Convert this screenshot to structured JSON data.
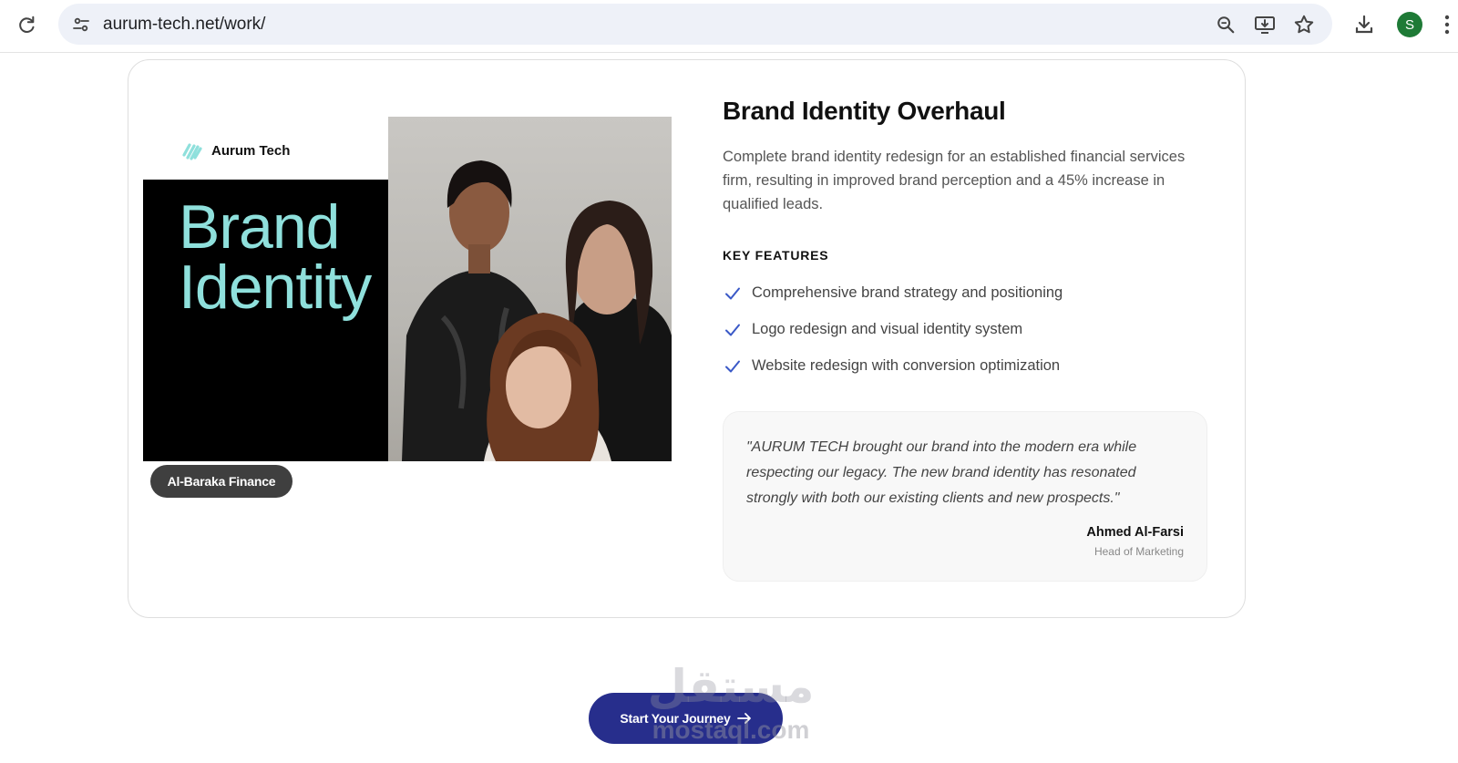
{
  "browser": {
    "url": "aurum-tech.net/work/",
    "avatar_letter": "S",
    "avatar_color": "#1e7a36"
  },
  "card": {
    "mockup": {
      "brand_name": "Aurum Tech",
      "headline_line1": "Brand",
      "headline_line2": "Identity",
      "accent_color": "#8fe0dc"
    },
    "client_label": "Al-Baraka Finance",
    "title": "Brand Identity Overhaul",
    "description": "Complete brand identity redesign for an established financial services firm, resulting in improved brand perception and a 45% increase in qualified leads.",
    "key_features_title": "KEY FEATURES",
    "features": [
      "Comprehensive brand strategy and positioning",
      "Logo redesign and visual identity system",
      "Website redesign with conversion optimization"
    ],
    "testimonial": {
      "quote": "\"AURUM TECH brought our brand into the modern era while respecting our legacy. The new brand identity has resonated strongly with both our existing clients and new prospects.\"",
      "author": "Ahmed Al-Farsi",
      "role": "Head of Marketing"
    }
  },
  "cta": {
    "label": "Start Your Journey",
    "color": "#272e8c"
  },
  "watermark": {
    "arabic": "مستقل",
    "latin": "mostaql.com"
  }
}
